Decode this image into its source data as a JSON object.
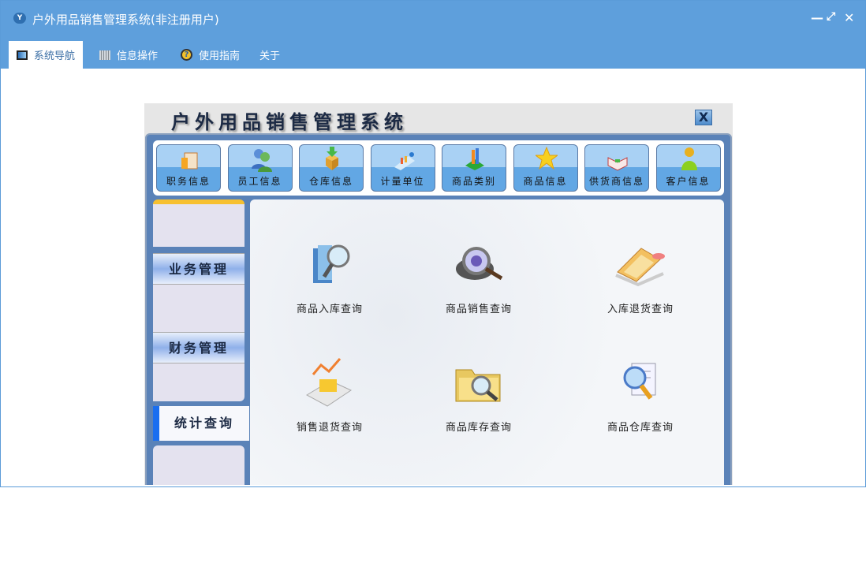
{
  "window": {
    "title": "户外用品销售管理系统(非注册用户)",
    "controls": [
      "minimize",
      "restore",
      "close"
    ]
  },
  "tabs": [
    {
      "label": "系统导航",
      "icon": "monitor-icon",
      "active": true
    },
    {
      "label": "信息操作",
      "icon": "grid-icon"
    },
    {
      "label": "使用指南",
      "icon": "help-icon"
    },
    {
      "label": "关于"
    }
  ],
  "panel": {
    "title": "户外用品销售管理系统",
    "close": "X"
  },
  "toolbar": [
    {
      "label": "职务信息"
    },
    {
      "label": "员工信息"
    },
    {
      "label": "仓库信息"
    },
    {
      "label": "计量单位"
    },
    {
      "label": "商品类别"
    },
    {
      "label": "商品信息"
    },
    {
      "label": "供货商信息"
    },
    {
      "label": "客户信息"
    }
  ],
  "sidebar": [
    {
      "label": "业务管理"
    },
    {
      "label": "财务管理"
    },
    {
      "label": "统计查询",
      "active": true
    }
  ],
  "items": [
    {
      "label": "商品入库查询"
    },
    {
      "label": "商品销售查询"
    },
    {
      "label": "入库退货查询"
    },
    {
      "label": "销售退货查询"
    },
    {
      "label": "商品库存查询"
    },
    {
      "label": "商品仓库查询"
    }
  ],
  "colors": {
    "titlebar": "#5e9fdc",
    "active_side": "#1a6ef0",
    "frame": "#5a82b8"
  }
}
